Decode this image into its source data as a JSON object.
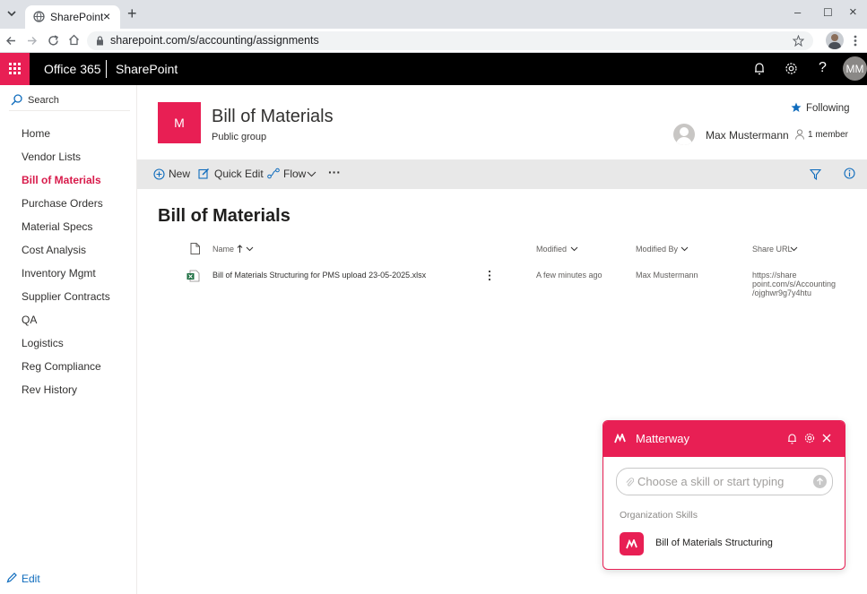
{
  "browser": {
    "tab_title": "SharePoint",
    "tab_close": "×",
    "new_tab": "+",
    "url": "sharepoint.com/s/accounting/assignments",
    "window_min": "–",
    "window_max": "☐",
    "window_close": "×"
  },
  "suite": {
    "office": "Office 365",
    "app": "SharePoint",
    "help": "?",
    "avatar": "MM"
  },
  "nav": {
    "search": "Search",
    "items": [
      {
        "label": "Home",
        "active": false
      },
      {
        "label": "Vendor Lists",
        "active": false
      },
      {
        "label": "Bill of Materials",
        "active": true
      },
      {
        "label": "Purchase Orders",
        "active": false
      },
      {
        "label": "Material Specs",
        "active": false
      },
      {
        "label": "Cost Analysis",
        "active": false
      },
      {
        "label": "Inventory Mgmt",
        "active": false
      },
      {
        "label": "Supplier Contracts",
        "active": false
      },
      {
        "label": "QA",
        "active": false
      },
      {
        "label": "Logistics",
        "active": false
      },
      {
        "label": "Reg Compliance",
        "active": false
      },
      {
        "label": "Rev History",
        "active": false
      }
    ],
    "edit": "Edit"
  },
  "site": {
    "logo_letter": "M",
    "title": "Bill of Materials",
    "subtitle": "Public group",
    "following": "Following",
    "owner": "Max Mustermann",
    "members": "1 member"
  },
  "commands": {
    "new": "New",
    "quick_edit": "Quick Edit",
    "flow": "Flow",
    "more": "···"
  },
  "list": {
    "title": "Bill of Materials",
    "columns": {
      "name": "Name",
      "modified": "Modified",
      "modified_by": "Modified By",
      "share_url": "Share URL"
    },
    "rows": [
      {
        "name": "Bill of Materials Structuring for PMS upload 23-05-2025.xlsx",
        "modified": "A few minutes ago",
        "modified_by": "Max Mustermann",
        "share_url_1": "https://share",
        "share_url_2": "point.com/s/Accounting",
        "share_url_3": "/ojghwr9g7y4htu"
      }
    ]
  },
  "matterway": {
    "title": "Matterway",
    "placeholder": "Choose a skill or start typing",
    "section": "Organization Skills",
    "skill": "Bill of Materials Structuring"
  },
  "colors": {
    "accent": "#e81f54",
    "nav_active": "#d81b4b",
    "link_blue": "#0f6cbd"
  }
}
